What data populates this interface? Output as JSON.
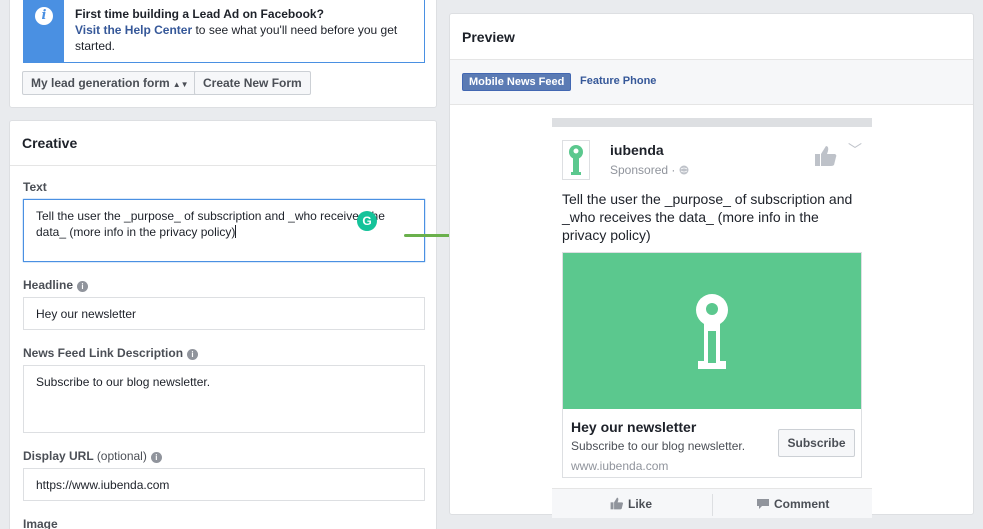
{
  "info": {
    "title": "First time building a Lead Ad on Facebook?",
    "link": "Visit the Help Center",
    "rest": " to see what you'll need before you get started.",
    "icon": "info-icon"
  },
  "form_select": {
    "value": "My lead generation form"
  },
  "create_form_label": "Create New Form",
  "creative": {
    "title": "Creative",
    "text_label": "Text",
    "text_value": "Tell the user the _purpose_ of subscription and _who receives the data_ (more info in the privacy policy)",
    "headline_label": "Headline",
    "headline_value": "Hey our newsletter",
    "link_desc_label": "News Feed Link Description",
    "link_desc_value": "Subscribe to our blog newsletter.",
    "display_url_label": "Display URL",
    "display_url_optional": "(optional)",
    "display_url_value": "https://www.iubenda.com",
    "image_label": "Image"
  },
  "grammarly_icon": "G",
  "preview": {
    "title": "Preview",
    "tabs": [
      {
        "label": "Mobile News Feed",
        "active": true
      },
      {
        "label": "Feature Phone",
        "active": false
      }
    ],
    "ad": {
      "page_name": "iubenda",
      "sponsored": "Sponsored ·",
      "text": "Tell the user the _purpose_ of subscription and _who receives the data_ (more info in the privacy policy)",
      "headline": "Hey our newsletter",
      "description": "Subscribe to our blog newsletter.",
      "url": "www.iubenda.com",
      "cta": "Subscribe",
      "actions": {
        "like": "Like",
        "comment": "Comment"
      }
    }
  },
  "colors": {
    "accent_blue": "#4a90e2",
    "brand_green": "#5bc88e",
    "facebook_blue": "#4267b2",
    "connector_green": "#6ab04c"
  }
}
